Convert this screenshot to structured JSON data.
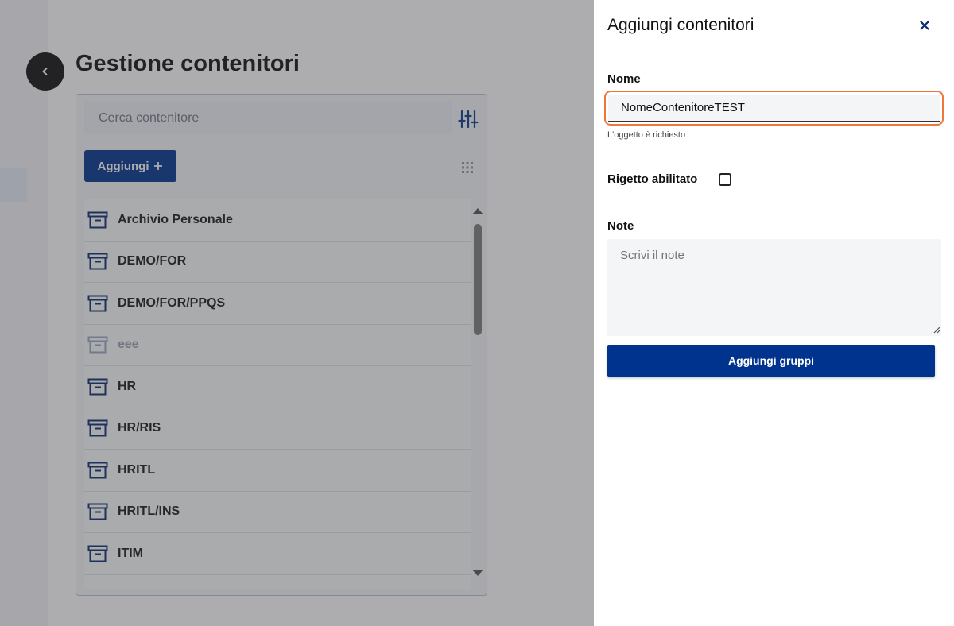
{
  "page": {
    "title": "Gestione contenitori"
  },
  "list": {
    "search_placeholder": "Cerca contenitore",
    "add_label": "Aggiungi",
    "add_icon": "plus-icon",
    "items": [
      {
        "label": "Archivio Personale",
        "disabled": false
      },
      {
        "label": "DEMO/FOR",
        "disabled": false
      },
      {
        "label": "DEMO/FOR/PPQS",
        "disabled": false
      },
      {
        "label": "eee",
        "disabled": true
      },
      {
        "label": "HR",
        "disabled": false
      },
      {
        "label": "HR/RIS",
        "disabled": false
      },
      {
        "label": "HRITL",
        "disabled": false
      },
      {
        "label": "HRITL/INS",
        "disabled": false
      },
      {
        "label": "ITIM",
        "disabled": false
      }
    ]
  },
  "drawer": {
    "title": "Aggiungi contenitori",
    "name_label": "Nome",
    "name_value": "NomeContenitoreTEST",
    "name_helper": "L'oggetto è richiesto",
    "reject_label": "Rigetto abilitato",
    "notes_label": "Note",
    "notes_placeholder": "Scrivi il note",
    "submit_label": "Aggiungi gruppi"
  },
  "colors": {
    "primary": "#00338d",
    "focus_border": "#f0773a"
  }
}
